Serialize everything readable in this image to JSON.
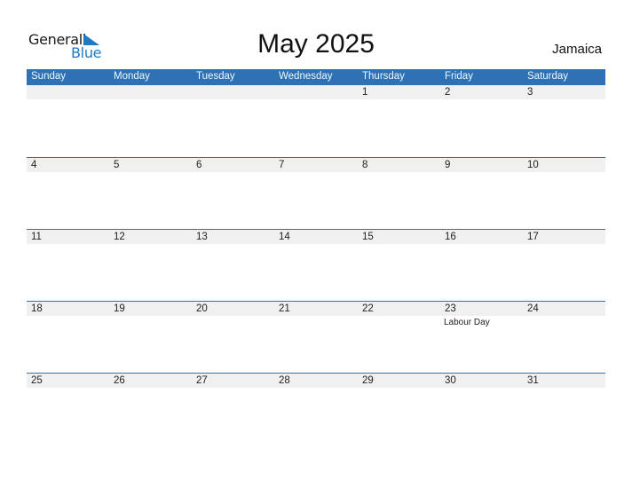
{
  "logo": {
    "general": "General",
    "blue": "Blue"
  },
  "title": "May 2025",
  "country": "Jamaica",
  "colors": {
    "accent": "#2e72b5",
    "band": "#f0f0f0",
    "logo_blue": "#1f7ac4"
  },
  "days": [
    "Sunday",
    "Monday",
    "Tuesday",
    "Wednesday",
    "Thursday",
    "Friday",
    "Saturday"
  ],
  "weeks": [
    [
      {
        "d": ""
      },
      {
        "d": ""
      },
      {
        "d": ""
      },
      {
        "d": ""
      },
      {
        "d": "1"
      },
      {
        "d": "2"
      },
      {
        "d": "3"
      }
    ],
    [
      {
        "d": "4"
      },
      {
        "d": "5"
      },
      {
        "d": "6"
      },
      {
        "d": "7"
      },
      {
        "d": "8"
      },
      {
        "d": "9"
      },
      {
        "d": "10"
      }
    ],
    [
      {
        "d": "11"
      },
      {
        "d": "12"
      },
      {
        "d": "13"
      },
      {
        "d": "14"
      },
      {
        "d": "15"
      },
      {
        "d": "16"
      },
      {
        "d": "17"
      }
    ],
    [
      {
        "d": "18"
      },
      {
        "d": "19"
      },
      {
        "d": "20"
      },
      {
        "d": "21"
      },
      {
        "d": "22"
      },
      {
        "d": "23",
        "event": "Labour Day"
      },
      {
        "d": "24"
      }
    ],
    [
      {
        "d": "25"
      },
      {
        "d": "26"
      },
      {
        "d": "27"
      },
      {
        "d": "28"
      },
      {
        "d": "29"
      },
      {
        "d": "30"
      },
      {
        "d": "31"
      }
    ]
  ]
}
